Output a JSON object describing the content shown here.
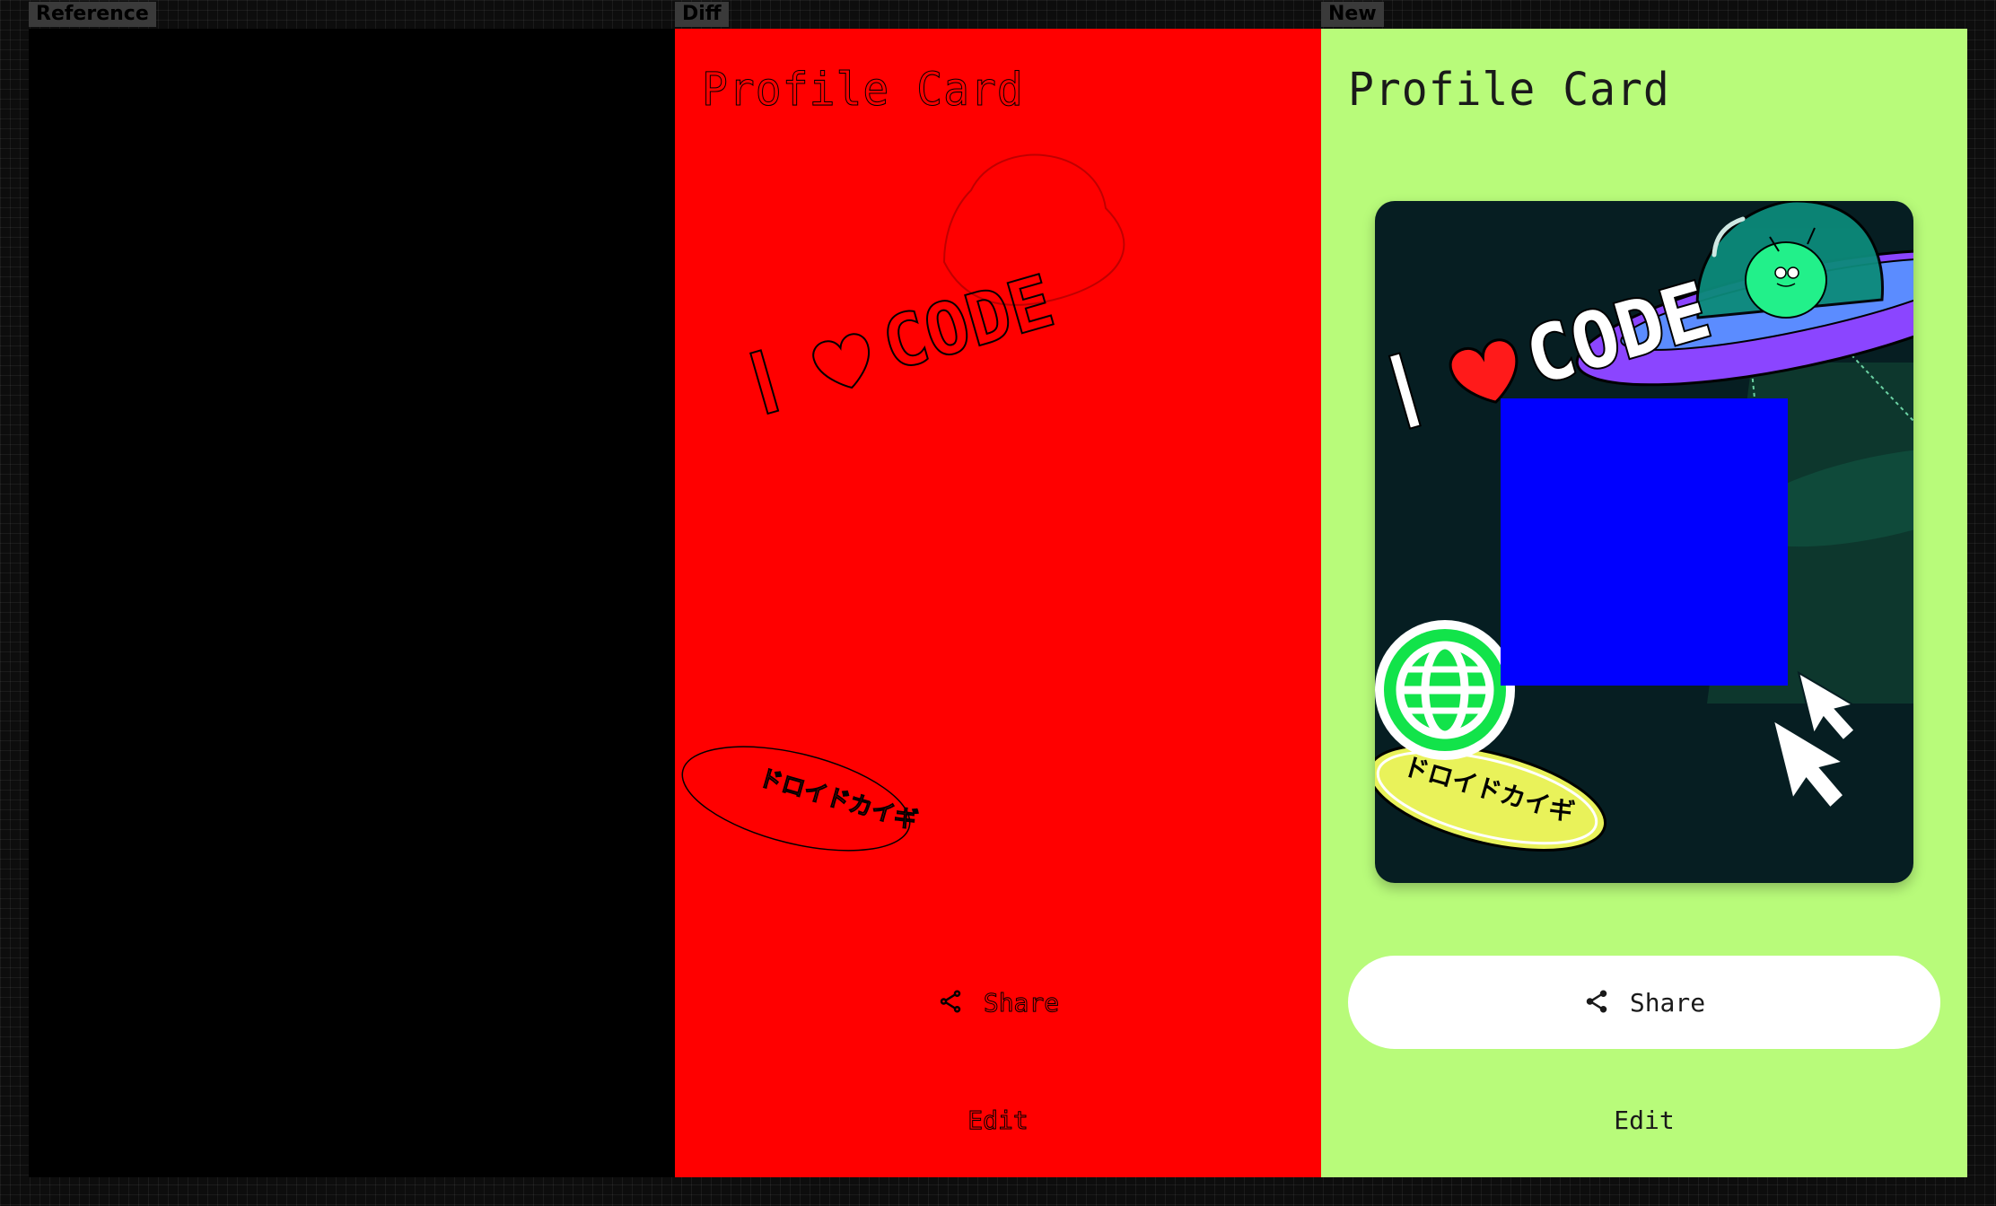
{
  "panels": {
    "reference": {
      "tag": "Reference"
    },
    "diff": {
      "tag": "Diff"
    },
    "new": {
      "tag": "New"
    }
  },
  "app": {
    "title": "Profile Card",
    "share_label": "Share",
    "edit_label": "Edit"
  },
  "card": {
    "sticker_code": "CODE",
    "sticker_i": "I",
    "sticker_kana": "ドロイドカイギ",
    "photo_color": "#0000ff"
  },
  "colors": {
    "reference_bg": "#000000",
    "diff_bg": "#ff0000",
    "new_bg": "#b8fb7a",
    "card_bg": "#061e22",
    "globe_green": "#12e34a",
    "ufo_purple": "#8b45ff",
    "badge_yellow": "#e9f25a"
  },
  "icons": {
    "share": "share-icon",
    "globe": "globe-icon",
    "heart": "heart-icon",
    "cursor": "cursor-icon",
    "ufo": "ufo-icon"
  }
}
